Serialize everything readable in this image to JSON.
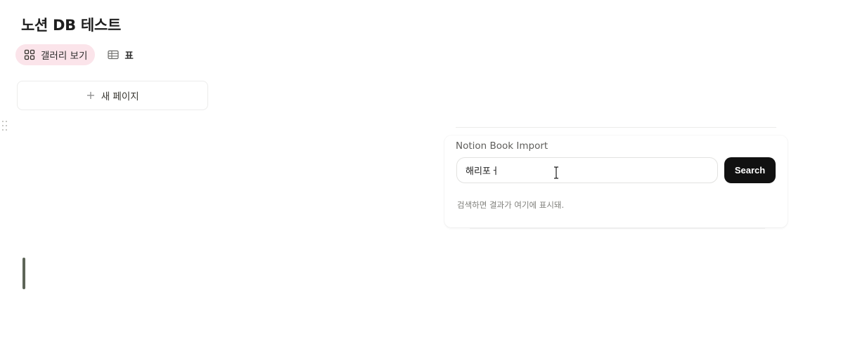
{
  "page": {
    "title": "노션 DB 테스트"
  },
  "views": [
    {
      "label": "갤러리 보기",
      "icon": "gallery-grid-icon",
      "active": true
    },
    {
      "label": "표",
      "icon": "table-icon",
      "active": false
    }
  ],
  "gallery": {
    "new_page_label": "새 페이지",
    "new_page_icon": "plus-icon"
  },
  "widget": {
    "title": "Notion Book Import",
    "search_value": "해리포ㅓ",
    "search_button_label": "Search",
    "hint": "검색하면 결과가 여기에 표시돼."
  },
  "colors": {
    "active_tab_bg": "#fbe4ea",
    "button_bg": "#111111",
    "left_bar": "#5d6558"
  }
}
